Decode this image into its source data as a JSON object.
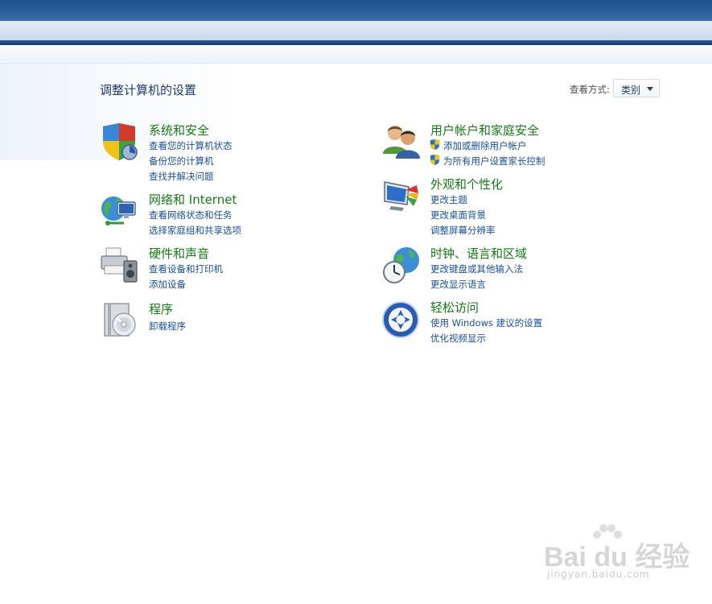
{
  "page": {
    "title": "调整计算机的设置",
    "view_by_label": "查看方式:",
    "view_by_value": "类别"
  },
  "categories": [
    {
      "id": "system-security",
      "icon": "shield-icon",
      "title": "系统和安全",
      "links": [
        "查看您的计算机状态",
        "备份您的计算机",
        "查找并解决问题"
      ]
    },
    {
      "id": "network-internet",
      "icon": "network-globe-icon",
      "title": "网络和 Internet",
      "links": [
        "查看网络状态和任务",
        "选择家庭组和共享选项"
      ]
    },
    {
      "id": "hardware-sound",
      "icon": "printer-speaker-icon",
      "title": "硬件和声音",
      "links": [
        "查看设备和打印机",
        "添加设备"
      ]
    },
    {
      "id": "programs",
      "icon": "programs-cd-icon",
      "title": "程序",
      "links": [
        "卸载程序"
      ]
    },
    {
      "id": "user-accounts",
      "icon": "users-icon",
      "title": "用户帐户和家庭安全",
      "links": [
        "添加或删除用户帐户",
        "为所有用户设置家长控制"
      ]
    },
    {
      "id": "appearance",
      "icon": "monitor-palette-icon",
      "title": "外观和个性化",
      "links": [
        "更改主题",
        "更改桌面背景",
        "调整屏幕分辨率"
      ]
    },
    {
      "id": "clock-language-region",
      "icon": "clock-globe-icon",
      "title": "时钟、语言和区域",
      "links": [
        "更改键盘或其他输入法",
        "更改显示语言"
      ]
    },
    {
      "id": "ease-of-access",
      "icon": "ease-of-access-icon",
      "title": "轻松访问",
      "links": [
        "使用 Windows 建议的设置",
        "优化视频显示"
      ]
    }
  ],
  "watermark": {
    "brand": "Bai du 经验",
    "url": "jingyan.baidu.com"
  },
  "colors": {
    "category_title": "#157a15",
    "link": "#1a4f99",
    "page_title": "#1e3b6f"
  }
}
